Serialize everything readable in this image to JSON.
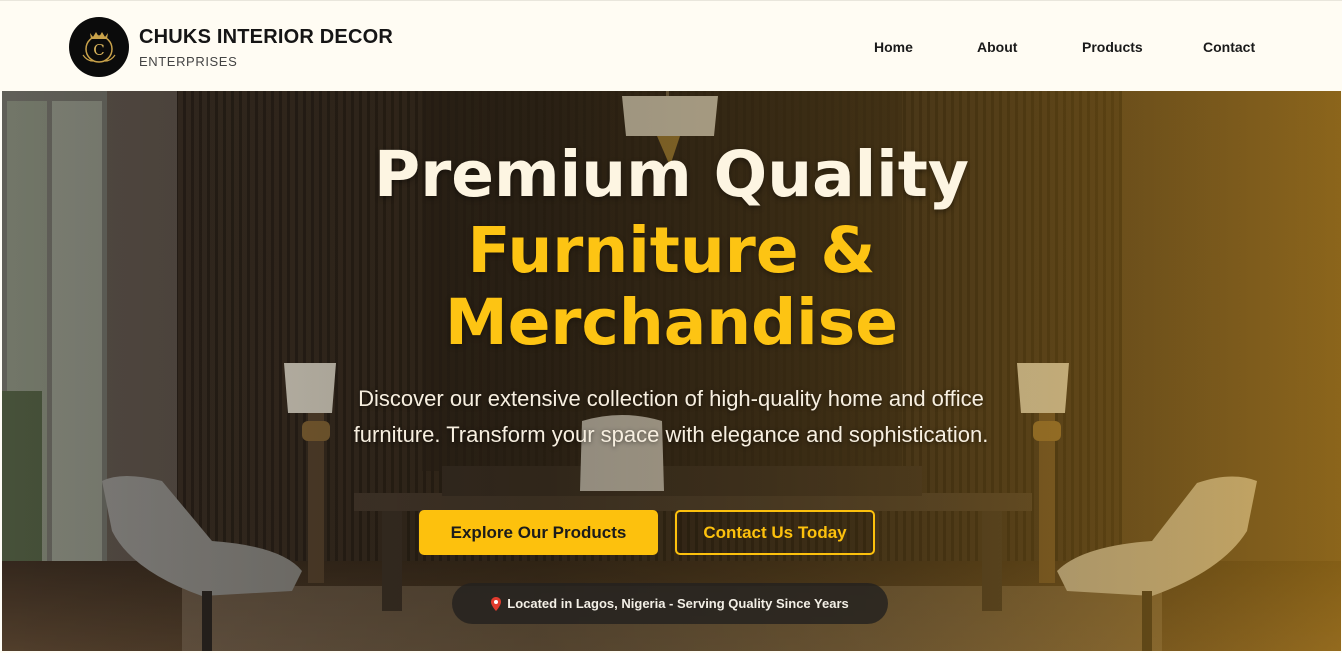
{
  "brand": {
    "title": "CHUKS INTERIOR DECOR",
    "subtitle": "ENTERPRISES",
    "logo_icon": "crown-c-monogram-icon",
    "logo_letter": "C"
  },
  "nav": {
    "items": [
      {
        "label": "Home"
      },
      {
        "label": "About"
      },
      {
        "label": "Products"
      },
      {
        "label": "Contact"
      }
    ]
  },
  "hero": {
    "headline_line1": "Premium Quality",
    "headline_line2": "Furniture &",
    "headline_line3": "Merchandise",
    "description": "Discover our extensive collection of high-quality home and office furniture. Transform your space with elegance and sophistication.",
    "primary_button": "Explore Our Products",
    "secondary_button": "Contact Us Today",
    "location_text": "Located in Lagos, Nigeria - Serving Quality Since Years",
    "location_icon": "map-pin-icon"
  },
  "colors": {
    "accent": "#fdc10d",
    "header_bg": "#fffcf3",
    "headline_light": "#fdf5e2"
  }
}
